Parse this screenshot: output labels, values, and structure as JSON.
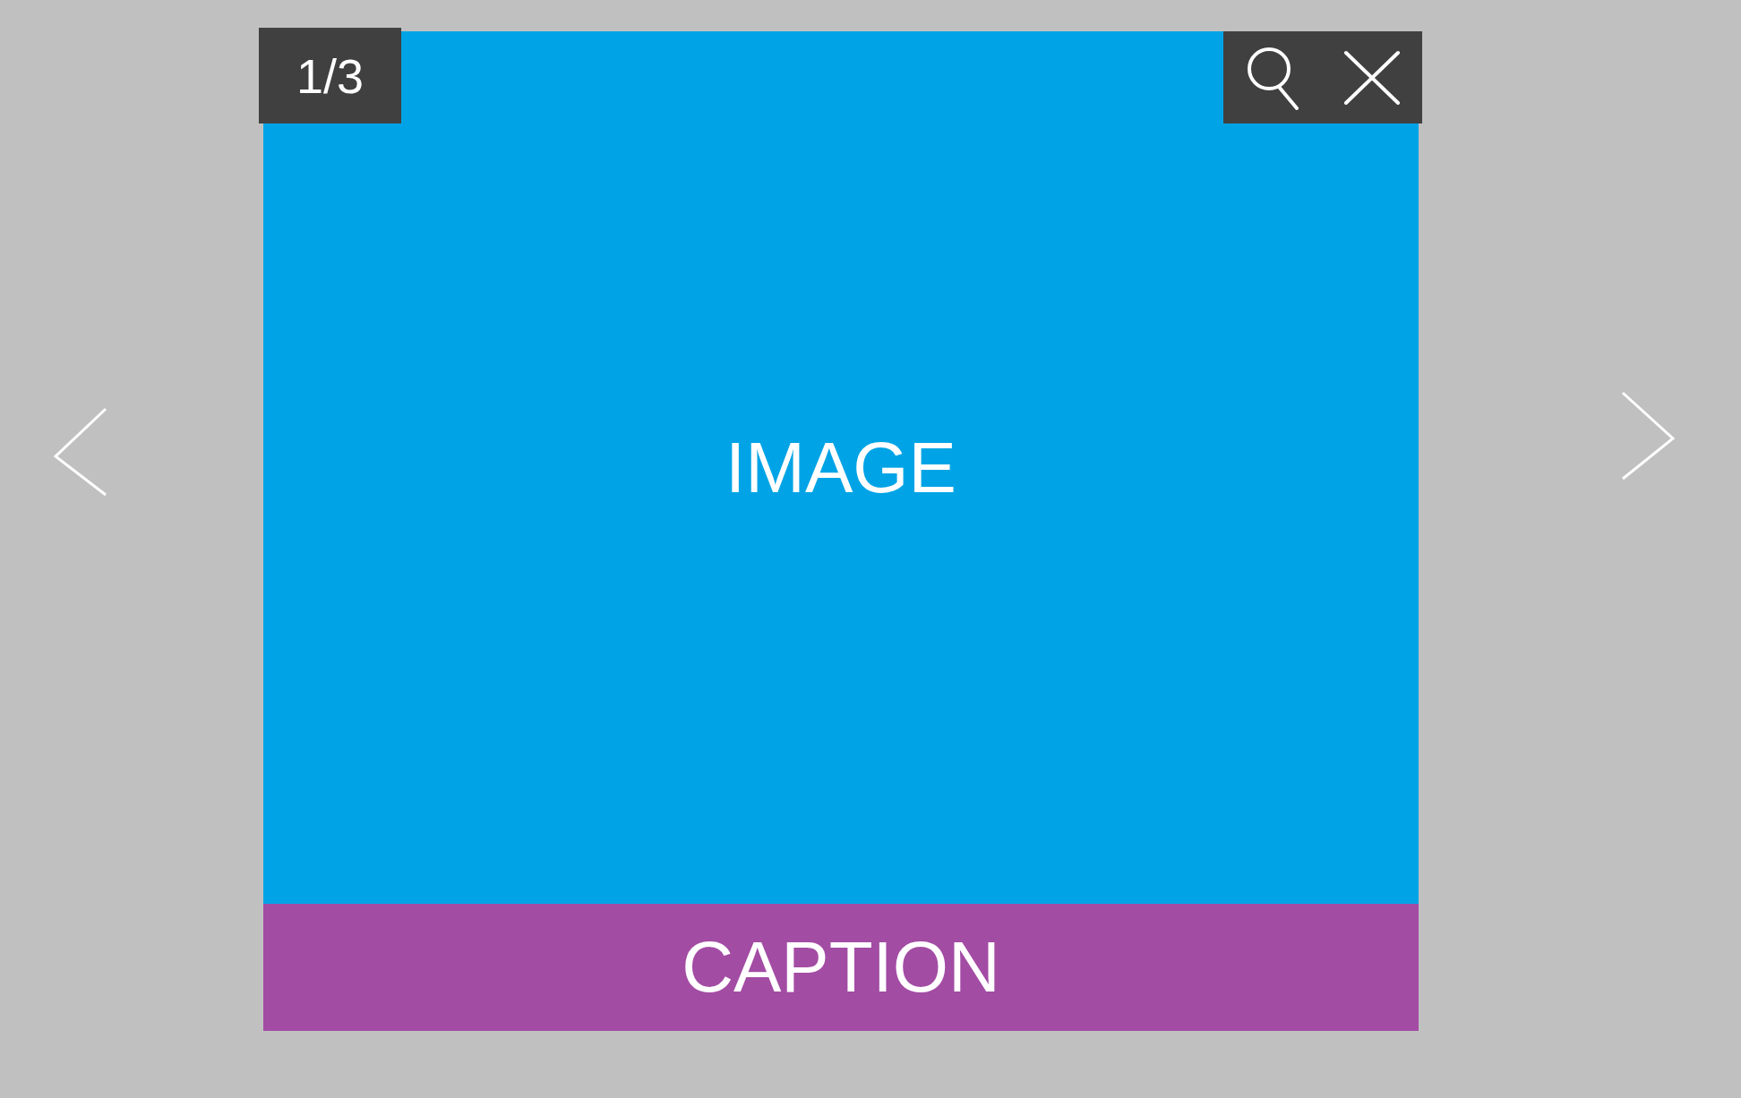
{
  "counter": "1/3",
  "image": {
    "label": "IMAGE"
  },
  "caption": "CAPTION"
}
